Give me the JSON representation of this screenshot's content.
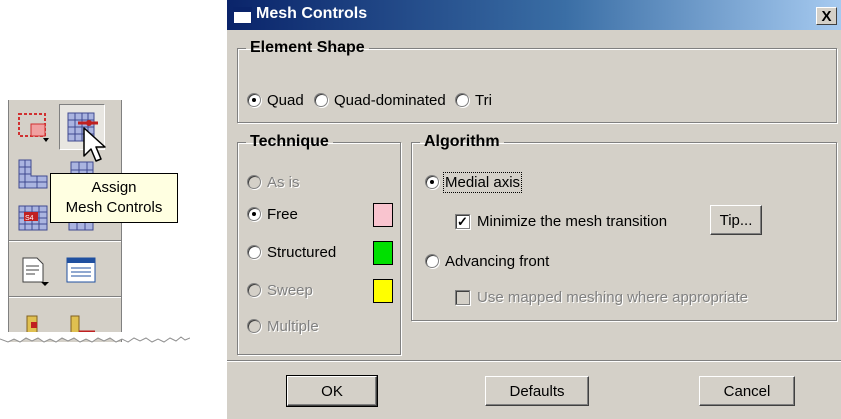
{
  "tooltip": {
    "line1": "Assign",
    "line2": "Mesh Controls"
  },
  "toolbox": {
    "icons": [
      "partition-face-icon",
      "assign-mesh-controls-icon",
      "seed-part-icon",
      "assign-element-type-icon",
      "mesh-part-icon",
      "verify-mesh-icon",
      "query-icon",
      "mesh-module-table-icon",
      "create-display-group-icon",
      "mesh-edit-icon"
    ]
  },
  "dialog": {
    "title": "Mesh Controls",
    "close_label": "X",
    "element_shape": {
      "legend": "Element Shape",
      "options": [
        "Quad",
        "Quad-dominated",
        "Tri"
      ],
      "selected": "Quad"
    },
    "technique": {
      "legend": "Technique",
      "options": [
        {
          "label": "As is",
          "enabled": false,
          "selected": false
        },
        {
          "label": "Free",
          "enabled": true,
          "selected": true,
          "color": "#f9c4cf"
        },
        {
          "label": "Structured",
          "enabled": true,
          "selected": false,
          "color": "#00e000"
        },
        {
          "label": "Sweep",
          "enabled": false,
          "selected": false,
          "color": "#ffff00"
        },
        {
          "label": "Multiple",
          "enabled": false,
          "selected": false
        }
      ]
    },
    "algorithm": {
      "legend": "Algorithm",
      "medial_axis": "Medial axis",
      "minimize": "Minimize the mesh transition",
      "tip_button": "Tip...",
      "advancing_front": "Advancing front",
      "mapped": "Use mapped meshing where appropriate"
    },
    "buttons": {
      "ok": "OK",
      "defaults": "Defaults",
      "cancel": "Cancel"
    }
  }
}
